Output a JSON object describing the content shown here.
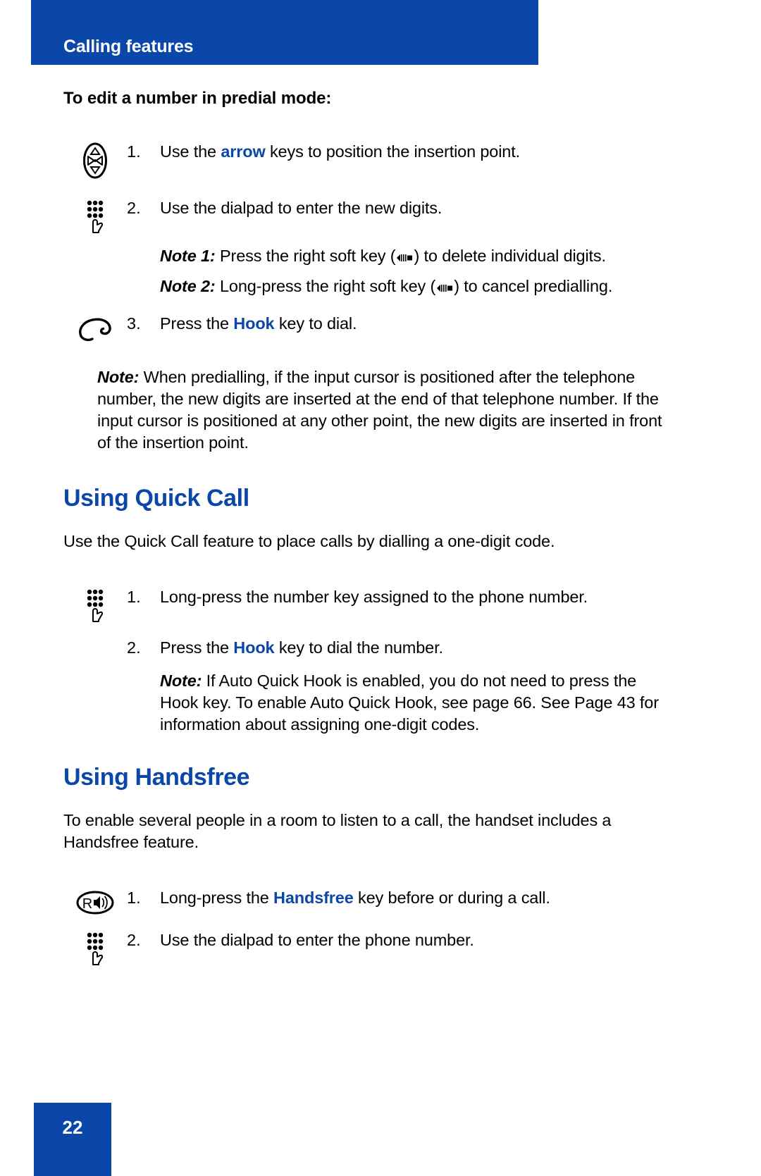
{
  "header": {
    "title": "Calling features",
    "band_color": "#0B47A8"
  },
  "subheading": "To edit a number in predial mode:",
  "predial_steps": [
    {
      "number": "1.",
      "icon": "navigation-arrow-key-icon",
      "text_before": "Use the ",
      "keyword": "arrow",
      "text_after": " keys to position the insertion point."
    },
    {
      "number": "2.",
      "icon": "dialpad-key-icon",
      "text_before": "Use the dialpad to enter the new digits.",
      "keyword": "",
      "text_after": ""
    },
    {
      "number": "3.",
      "icon": "hook-key-icon",
      "text_before": "Press the ",
      "keyword": "Hook",
      "text_after": " key to dial."
    }
  ],
  "predial_notes": [
    {
      "lead": "Note 1:",
      "before_glyph": " Press the right soft key (",
      "after_glyph": ") to delete individual digits."
    },
    {
      "lead": "Note 2:",
      "before_glyph": " Long-press the right soft key (",
      "after_glyph": ") to cancel predialling."
    }
  ],
  "predial_main_note": {
    "lead": "Note:",
    "text": " When predialling, if the input cursor is positioned after the telephone number, the new digits are inserted at the end of that telephone number. If the input cursor is positioned at any other point, the new digits are inserted in front of the insertion point."
  },
  "quick_call": {
    "heading": "Using Quick Call",
    "intro": "Use the Quick Call feature to place calls by dialling a one-digit code.",
    "steps": [
      {
        "number": "1.",
        "icon": "dialpad-key-icon",
        "text_before": "Long-press the number key assigned to the phone number.",
        "keyword": "",
        "text_after": ""
      },
      {
        "number": "2.",
        "icon": "",
        "text_before": "Press the ",
        "keyword": "Hook",
        "text_after": " key to dial the number."
      }
    ],
    "note": {
      "lead": "Note:",
      "text": " If Auto Quick Hook is enabled, you do not need to press the Hook key. To enable Auto Quick Hook, see page 66. See Page 43 for information about assigning one-digit codes."
    }
  },
  "handsfree": {
    "heading": "Using Handsfree",
    "intro": "To enable several people in a room to listen to a call, the handset includes a Handsfree feature.",
    "steps": [
      {
        "number": "1.",
        "icon": "handsfree-speaker-key-icon",
        "text_before": "Long-press the ",
        "keyword": "Handsfree",
        "text_after": " key before or during a call."
      },
      {
        "number": "2.",
        "icon": "dialpad-key-icon",
        "text_before": "Use the dialpad to enter the phone number.",
        "keyword": "",
        "text_after": ""
      }
    ]
  },
  "footer": {
    "page_number": "22",
    "tab_color": "#0B47A8"
  },
  "colors": {
    "accent_blue": "#0B47A8",
    "text_black": "#000000",
    "page_white": "#ffffff"
  }
}
